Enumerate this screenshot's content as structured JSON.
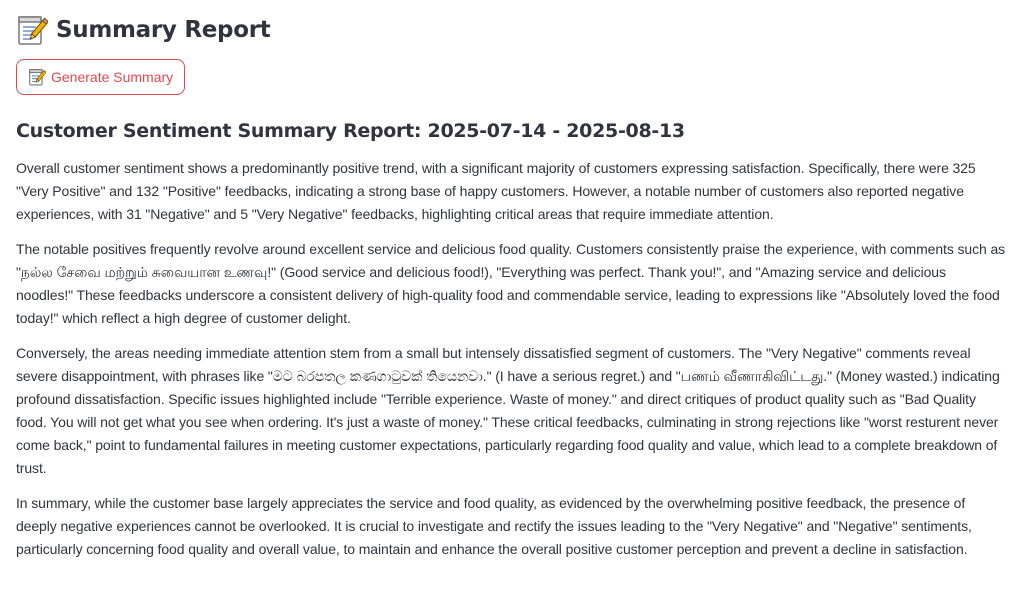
{
  "header": {
    "title": "Summary Report",
    "icon": "memo-icon"
  },
  "toolbar": {
    "generate_label": "Generate Summary",
    "generate_icon": "memo-icon",
    "accent_color": "#e0484f"
  },
  "report": {
    "heading": "Customer Sentiment Summary Report: 2025-07-14 - 2025-08-13",
    "paragraphs": [
      "Overall customer sentiment shows a predominantly positive trend, with a significant majority of customers expressing satisfaction. Specifically, there were 325 \"Very Positive\" and 132 \"Positive\" feedbacks, indicating a strong base of happy customers. However, a notable number of customers also reported negative experiences, with 31 \"Negative\" and 5 \"Very Negative\" feedbacks, highlighting critical areas that require immediate attention.",
      "The notable positives frequently revolve around excellent service and delicious food quality. Customers consistently praise the experience, with comments such as \"நல்ல சேவை மற்றும் சுவையான உணவு!\" (Good service and delicious food!), \"Everything was perfect. Thank you!\", and \"Amazing service and delicious noodles!\" These feedbacks underscore a consistent delivery of high-quality food and commendable service, leading to expressions like \"Absolutely loved the food today!\" which reflect a high degree of customer delight.",
      "Conversely, the areas needing immediate attention stem from a small but intensely dissatisfied segment of customers. The \"Very Negative\" comments reveal severe disappointment, with phrases like \"මට බරපතල කණගාටුවක් තියෙනවා.\" (I have a serious regret.) and \"பணம் வீணாகிவிட்டது.\" (Money wasted.) indicating profound dissatisfaction. Specific issues highlighted include \"Terrible experience. Waste of money.\" and direct critiques of product quality such as \"Bad Quality food. You will not get what you see when ordering. It's just a waste of money.\" These critical feedbacks, culminating in strong rejections like \"worst resturent never come back,\" point to fundamental failures in meeting customer expectations, particularly regarding food quality and value, which lead to a complete breakdown of trust.",
      "In summary, while the customer base largely appreciates the service and food quality, as evidenced by the overwhelming positive feedback, the presence of deeply negative experiences cannot be overlooked. It is crucial to investigate and rectify the issues leading to the \"Very Negative\" and \"Negative\" sentiments, particularly concerning food quality and overall value, to maintain and enhance the overall positive customer perception and prevent a decline in satisfaction."
    ]
  }
}
